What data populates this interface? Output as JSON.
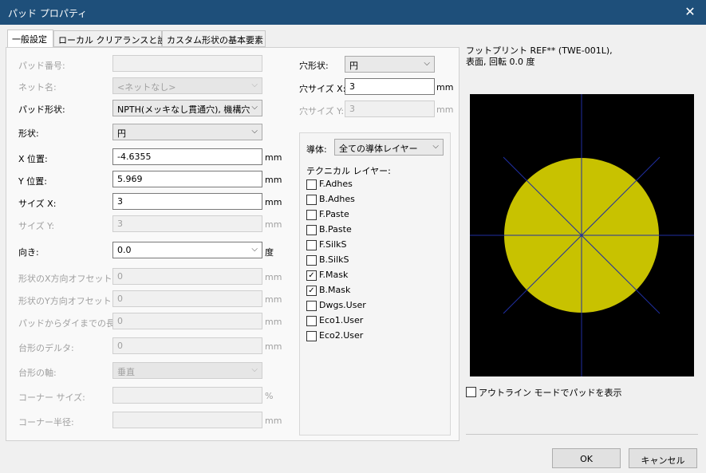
{
  "window": {
    "title": "パッド プロパティ",
    "close_glyph": "✕"
  },
  "tabs": [
    "一般設定",
    "ローカル クリアランスと設定",
    "カスタム形状の基本要素"
  ],
  "left_fields": [
    {
      "label": "パッド番号:",
      "value": "",
      "unit": ""
    },
    {
      "label": "ネット名:",
      "value": "<ネットなし>",
      "unit": ""
    },
    {
      "label": "パッド形状:",
      "value": "NPTH(メッキなし貫通穴), 機構穴",
      "unit": ""
    },
    {
      "label": "形状:",
      "value": "円",
      "unit": ""
    },
    {
      "label": "X 位置:",
      "value": "-4.6355",
      "unit": "mm"
    },
    {
      "label": "Y 位置:",
      "value": "5.969",
      "unit": "mm"
    },
    {
      "label": "サイズ X:",
      "value": "3",
      "unit": "mm"
    },
    {
      "label": "サイズ Y:",
      "value": "3",
      "unit": "mm"
    },
    {
      "label": "向き:",
      "value": "0.0",
      "unit": "度"
    },
    {
      "label": "形状のX方向オフセット:",
      "value": "0",
      "unit": "mm"
    },
    {
      "label": "形状のY方向オフセット:",
      "value": "0",
      "unit": "mm"
    },
    {
      "label": "パッドからダイまでの長さ:",
      "value": "0",
      "unit": "mm"
    },
    {
      "label": "台形のデルタ:",
      "value": "0",
      "unit": "mm"
    },
    {
      "label": "台形の軸:",
      "value": "垂直",
      "unit": ""
    },
    {
      "label": "コーナー サイズ:",
      "value": "",
      "unit": "%"
    },
    {
      "label": "コーナー半径:",
      "value": "",
      "unit": "mm"
    }
  ],
  "drill": {
    "shape_label": "穴形状:",
    "shape_value": "円",
    "size_x_label": "穴サイズ X:",
    "size_x_value": "3",
    "size_x_unit": "mm",
    "size_y_label": "穴サイズ Y:",
    "size_y_value": "3",
    "size_y_unit": "mm"
  },
  "layers": {
    "conductor_label": "導体:",
    "conductor_value": "全ての導体レイヤー",
    "technical_label": "テクニカル レイヤー:",
    "items": [
      {
        "name": "F.Adhes",
        "checked": false
      },
      {
        "name": "B.Adhes",
        "checked": false
      },
      {
        "name": "F.Paste",
        "checked": false
      },
      {
        "name": "B.Paste",
        "checked": false
      },
      {
        "name": "F.SilkS",
        "checked": false
      },
      {
        "name": "B.SilkS",
        "checked": false
      },
      {
        "name": "F.Mask",
        "checked": true
      },
      {
        "name": "B.Mask",
        "checked": true
      },
      {
        "name": "Dwgs.User",
        "checked": false
      },
      {
        "name": "Eco1.User",
        "checked": false
      },
      {
        "name": "Eco2.User",
        "checked": false
      }
    ]
  },
  "footprint_info": {
    "line1": "フットプリント REF** (TWE-001L),",
    "line2": "表面, 回転 0.0 度"
  },
  "outline_mode_label": "アウトライン モードでパッドを表示",
  "buttons": {
    "ok": "OK",
    "cancel": "キャンセル"
  },
  "colors": {
    "pad_fill": "#c8c200",
    "preview_bg": "#000000",
    "crosshair": "#1f2ea0",
    "title_bar": "#1e4f7a"
  },
  "icons": {
    "dropdown": "⌵",
    "check": "✓"
  }
}
